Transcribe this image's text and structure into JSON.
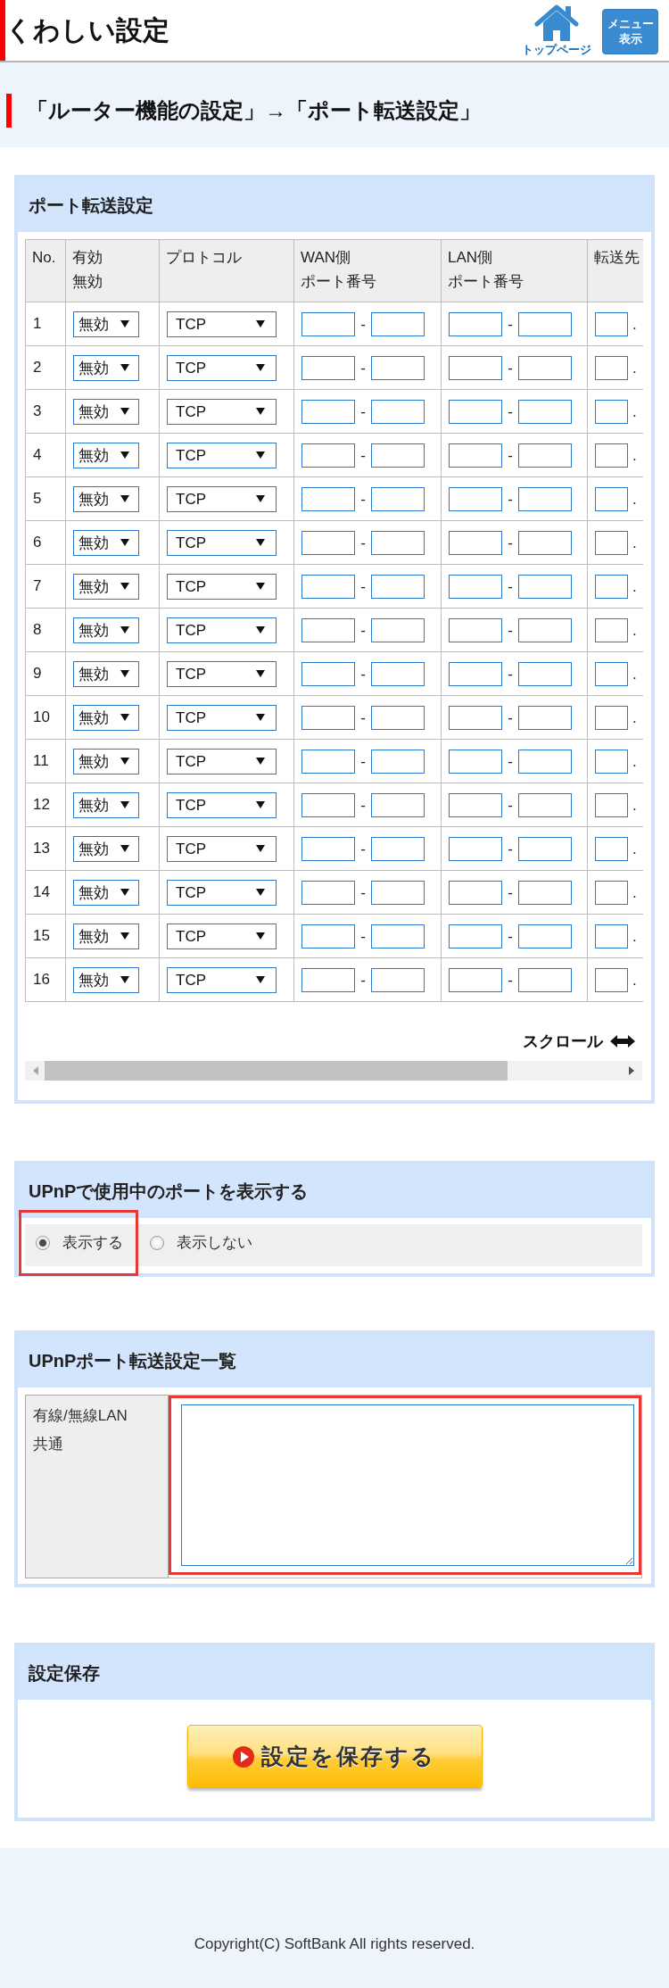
{
  "header": {
    "title": "くわしい設定",
    "home_link": {
      "label": "トップページ"
    },
    "menu_button": {
      "label_lines": [
        "メニュー",
        "表示"
      ]
    }
  },
  "breadcrumb": "「ルーター機能の設定」→「ポート転送設定」",
  "port_forwarding": {
    "title": "ポート転送設定",
    "columns": [
      {
        "lines": [
          "No."
        ]
      },
      {
        "lines": [
          "有効",
          "無効"
        ]
      },
      {
        "lines": [
          "プロトコル"
        ]
      },
      {
        "lines": [
          "WAN側",
          "ポート番号"
        ]
      },
      {
        "lines": [
          "LAN側",
          "ポート番号"
        ]
      },
      {
        "lines": [
          "転送先"
        ]
      }
    ],
    "rows": [
      {
        "no": "1",
        "status": "無効",
        "protocol": "TCP",
        "wan_separator": "-",
        "lan_separator": "-",
        "address_separator": "."
      },
      {
        "no": "2",
        "status": "無効",
        "protocol": "TCP",
        "wan_separator": "-",
        "lan_separator": "-",
        "address_separator": "."
      },
      {
        "no": "3",
        "status": "無効",
        "protocol": "TCP",
        "wan_separator": "-",
        "lan_separator": "-",
        "address_separator": "."
      },
      {
        "no": "4",
        "status": "無効",
        "protocol": "TCP",
        "wan_separator": "-",
        "lan_separator": "-",
        "address_separator": "."
      },
      {
        "no": "5",
        "status": "無効",
        "protocol": "TCP",
        "wan_separator": "-",
        "lan_separator": "-",
        "address_separator": "."
      },
      {
        "no": "6",
        "status": "無効",
        "protocol": "TCP",
        "wan_separator": "-",
        "lan_separator": "-",
        "address_separator": "."
      },
      {
        "no": "7",
        "status": "無効",
        "protocol": "TCP",
        "wan_separator": "-",
        "lan_separator": "-",
        "address_separator": "."
      },
      {
        "no": "8",
        "status": "無効",
        "protocol": "TCP",
        "wan_separator": "-",
        "lan_separator": "-",
        "address_separator": "."
      },
      {
        "no": "9",
        "status": "無効",
        "protocol": "TCP",
        "wan_separator": "-",
        "lan_separator": "-",
        "address_separator": "."
      },
      {
        "no": "10",
        "status": "無効",
        "protocol": "TCP",
        "wan_separator": "-",
        "lan_separator": "-",
        "address_separator": "."
      },
      {
        "no": "11",
        "status": "無効",
        "protocol": "TCP",
        "wan_separator": "-",
        "lan_separator": "-",
        "address_separator": "."
      },
      {
        "no": "12",
        "status": "無効",
        "protocol": "TCP",
        "wan_separator": "-",
        "lan_separator": "-",
        "address_separator": "."
      },
      {
        "no": "13",
        "status": "無効",
        "protocol": "TCP",
        "wan_separator": "-",
        "lan_separator": "-",
        "address_separator": "."
      },
      {
        "no": "14",
        "status": "無効",
        "protocol": "TCP",
        "wan_separator": "-",
        "lan_separator": "-",
        "address_separator": "."
      },
      {
        "no": "15",
        "status": "無効",
        "protocol": "TCP",
        "wan_separator": "-",
        "lan_separator": "-",
        "address_separator": "."
      },
      {
        "no": "16",
        "status": "無効",
        "protocol": "TCP",
        "wan_separator": "-",
        "lan_separator": "-",
        "address_separator": "."
      }
    ],
    "scroll_hint": "スクロール"
  },
  "upnp_display": {
    "title": "UPnPで使用中のポートを表示する",
    "options": [
      {
        "label": "表示する",
        "selected": true,
        "highlighted": true
      },
      {
        "label": "表示しない",
        "selected": false,
        "highlighted": false
      }
    ]
  },
  "upnp_list": {
    "title": "UPnPポート転送設定一覧",
    "label_lines": [
      "有線/無線LAN",
      "共通"
    ],
    "field": {
      "highlighted": true
    }
  },
  "save": {
    "title": "設定保存",
    "button": "設定を保存する"
  },
  "footer": {
    "copyright": "Copyright(C) SoftBank All rights reserved."
  }
}
